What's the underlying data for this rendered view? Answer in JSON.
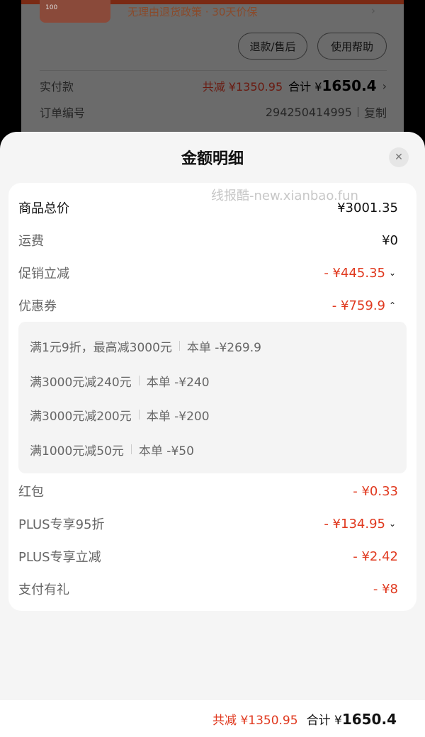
{
  "background": {
    "thumb_text": "100",
    "policy_text": "无理由退货政策 · 30天价保",
    "policy_arrow": "›",
    "refund_button": "退款/售后",
    "help_button": "使用帮助",
    "paid_label": "实付款",
    "paid_saved": "共减 ¥1350.95",
    "paid_total_prefix": "合计 ¥",
    "paid_total_value": "1650.4",
    "paid_arrow": "›",
    "order_label": "订单编号",
    "order_number": "294250414995",
    "copy_label": "复制"
  },
  "sheet": {
    "title": "金额明细",
    "close_icon": "✕",
    "watermark": "线报酷-new.xianbao.fun"
  },
  "rows": [
    {
      "label": "商品总价",
      "value": "¥3001.35"
    },
    {
      "label": "运费",
      "value": "¥0"
    },
    {
      "label": "促销立减",
      "value": "- ¥445.35",
      "chevron": "⌄"
    },
    {
      "label": "优惠券",
      "value": "- ¥759.9",
      "chevron": "⌃"
    },
    {
      "label": "红包",
      "value": "- ¥0.33"
    },
    {
      "label": "PLUS专享95折",
      "value": "- ¥134.95",
      "chevron": "⌄"
    },
    {
      "label": "PLUS专享立减",
      "value": "- ¥2.42"
    },
    {
      "label": "支付有礼",
      "value": "- ¥8"
    }
  ],
  "coupons": [
    {
      "rule": "满1元9折，最高减3000元",
      "amount": "本单 -¥269.9"
    },
    {
      "rule": "满3000元减240元",
      "amount": "本单 -¥240"
    },
    {
      "rule": "满3000元减200元",
      "amount": "本单 -¥200"
    },
    {
      "rule": "满1000元减50元",
      "amount": "本单 -¥50"
    }
  ],
  "bottom": {
    "saved": "共减 ¥1350.95",
    "total_prefix": "合计 ¥",
    "total_value": "1650.4"
  },
  "colors": {
    "accent_red": "#e0391f",
    "sheet_bg": "#f5f5f5"
  }
}
